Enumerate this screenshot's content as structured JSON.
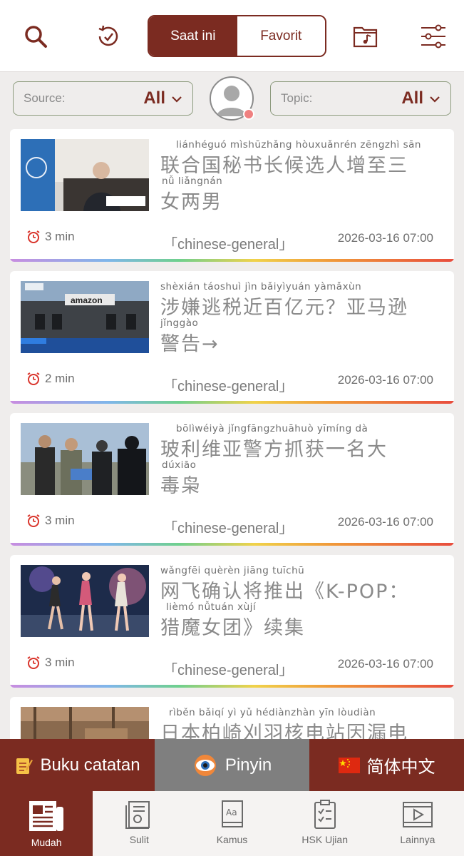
{
  "header": {
    "tabs": {
      "active": "Saat ini",
      "inactive": "Favorit"
    }
  },
  "filters": {
    "source_label": "Source:",
    "source_value": "All",
    "topic_label": "Topic:",
    "topic_value": "All"
  },
  "articles": [
    {
      "lines": [
        {
          "pinyin": "liánhéguó  mìshūzhǎng hòuxuǎnrén zēngzhì sān",
          "text": "联合国秘书长候选人增至三"
        },
        {
          "pinyin": "nǚ liǎngnán",
          "text": "女两男"
        }
      ],
      "time": "3 min",
      "category": "「chinese-general」",
      "date": "2026-03-16 07:00"
    },
    {
      "lines": [
        {
          "pinyin": "shèxián táoshuì  jìn   bǎiyìyuán            yàmǎxùn",
          "text": "涉嫌逃税近百亿元？亚马逊"
        },
        {
          "pinyin": "jǐnggào",
          "text": "警告→"
        }
      ],
      "time": "2 min",
      "category": "「chinese-general」",
      "date": "2026-03-16 07:00"
    },
    {
      "lines": [
        {
          "pinyin": "bōlìwéiyà   jǐngfāngzhuāhuò yīmíng  dà",
          "text": "玻利维亚警方抓获一名大"
        },
        {
          "pinyin": "dúxiāo",
          "text": "毒枭"
        }
      ],
      "time": "3 min",
      "category": "「chinese-general」",
      "date": "2026-03-16 07:00"
    },
    {
      "lines": [
        {
          "pinyin": "wǎngfēi quèrèn jiāng tuīchū",
          "text": "网飞确认将推出《K-POP："
        },
        {
          "pinyin": "lièmó  nǚtuán        xùjí",
          "text": "猎魔女团》续集"
        }
      ],
      "time": "3 min",
      "category": "「chinese-general」",
      "date": "2026-03-16 07:00"
    },
    {
      "lines": [
        {
          "pinyin": "rìběn    bǎiqí    yì   yǔ  hédiànzhàn  yīn  lòudiàn",
          "text": "日本柏崎刈羽核电站因漏电"
        }
      ]
    }
  ],
  "action_bar": {
    "notebook": "Buku catatan",
    "pinyin": "Pinyin",
    "language": "简体中文"
  },
  "bottom_nav": [
    {
      "label": "Mudah",
      "icon": "newspaper-icon"
    },
    {
      "label": "Sulit",
      "icon": "document-icon"
    },
    {
      "label": "Kamus",
      "icon": "dictionary-icon"
    },
    {
      "label": "HSK Ujian",
      "icon": "checklist-icon"
    },
    {
      "label": "Lainnya",
      "icon": "video-icon"
    }
  ],
  "colors": {
    "brand": "#7b2b21",
    "pinyin_bar": "#7f7f7f",
    "background": "#efedec"
  }
}
